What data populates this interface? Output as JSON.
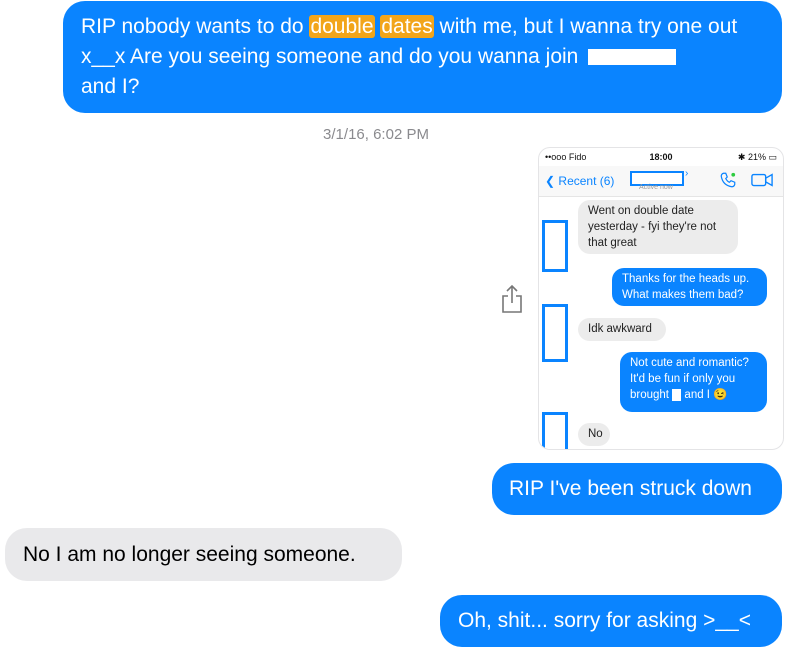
{
  "messages": {
    "first": {
      "part1": "RIP nobody wants to do ",
      "hl1": "double",
      "space": " ",
      "hl2": "dates",
      "part2": " with me, but I wanna try one out x__x Are you seeing someone and do you wanna join ",
      "part3": " and I?"
    },
    "timestamp": "3/1/16, 6:02 PM",
    "second": "RIP I've been struck down",
    "third": "No I am no longer seeing someone.",
    "fourth": "Oh, shit... sorry for asking >__<"
  },
  "screenshot": {
    "status": {
      "carrier": "••ooo Fido",
      "time": "18:00",
      "battery": "21%"
    },
    "nav": {
      "back": "Recent (6)",
      "active": "Active now"
    },
    "msgs": {
      "m1": "Went on double date yesterday - fyi they're not that great",
      "m2": "Thanks for the heads up. What makes them bad?",
      "m3": "Idk awkward",
      "m4a": "Not cute and romantic? It'd be fun if only you brought",
      "m4b": "and I",
      "m4emoji": "😉",
      "m5": "No"
    }
  },
  "icons": {
    "share": "share-icon",
    "phone": "phone-icon",
    "video": "video-icon",
    "back": "chevron-left-icon"
  },
  "colors": {
    "outgoing": "#0a84ff",
    "incoming": "#e9e9eb",
    "highlight": "#f2a51a"
  }
}
